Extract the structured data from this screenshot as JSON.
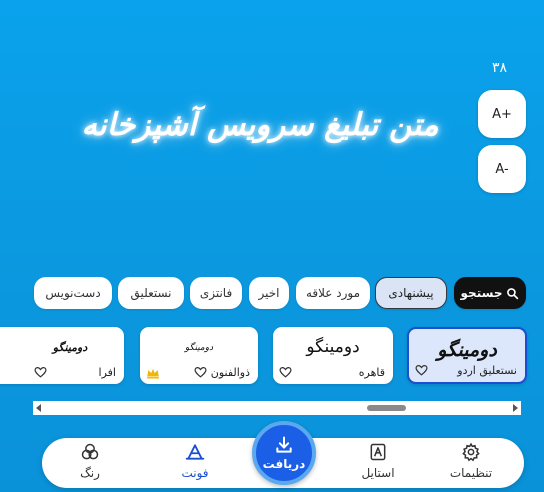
{
  "size_control": {
    "count": "۳۸",
    "increase_label": "A+",
    "decrease_label": "A-"
  },
  "preview": {
    "text": "متن تبلیغ سرویس آشپزخانه"
  },
  "categories": {
    "search_label": "جستجو",
    "items": [
      {
        "label": "پیشنهادی",
        "active": true
      },
      {
        "label": "مورد علاقه",
        "active": false
      },
      {
        "label": "اخیر",
        "active": false
      },
      {
        "label": "فانتزی",
        "active": false
      },
      {
        "label": "نستعلیق",
        "active": false
      },
      {
        "label": "دست‌نویس",
        "active": false
      }
    ]
  },
  "fonts": [
    {
      "sample": "دومینگو",
      "name": "نستعلیق اردو",
      "selected": true,
      "premium": false
    },
    {
      "sample": "دومینگو",
      "name": "قاهره",
      "selected": false,
      "premium": false
    },
    {
      "sample": "دومینگو",
      "name": "ذوالفنون",
      "selected": false,
      "premium": true
    },
    {
      "sample": "دومینگو",
      "name": "افرا",
      "selected": false,
      "premium": false
    }
  ],
  "bottom_nav": {
    "settings_label": "تنظیمات",
    "style_label": "استایل",
    "download_label": "دریافت",
    "font_label": "فونت",
    "color_label": "رنگ"
  },
  "colors": {
    "background": "#0aa2ec",
    "accent": "#1a5fe6",
    "selected_card": "#dde7fb",
    "crown": "#f2b705"
  }
}
